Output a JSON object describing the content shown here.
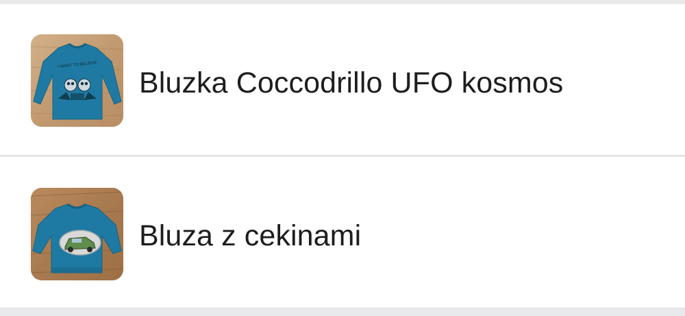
{
  "items": [
    {
      "title": "Bluzka Coccodrillo UFO kosmos",
      "thumbnail": "blue-long-sleeve-shirt-with-ufo-print",
      "thumbnail_print_text": "I WANT TO BELIEVE"
    },
    {
      "title": "Bluza z cekinami",
      "thumbnail": "blue-sweatshirt-with-sequin-car-patch"
    }
  ],
  "colors": {
    "background": "#e9eaec",
    "card": "#ffffff",
    "text": "#1d1d1f",
    "shirt_blue": "#1f7aa3",
    "wood": "#c49b72"
  }
}
